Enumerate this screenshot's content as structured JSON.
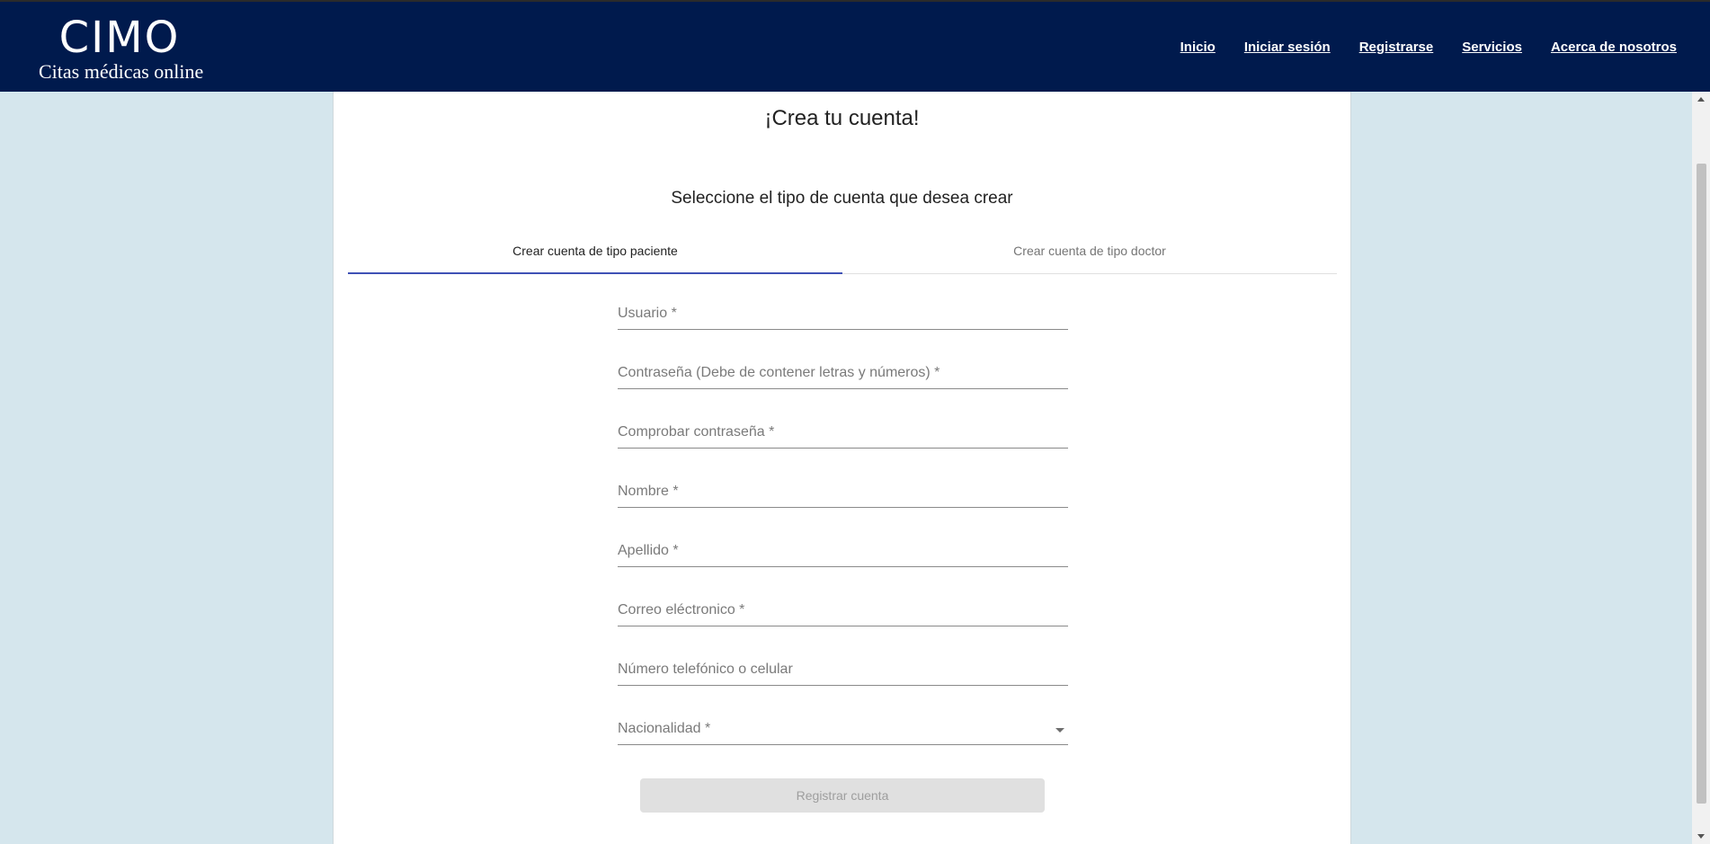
{
  "header": {
    "logo_title": "CIMO",
    "logo_subtitle": "Citas médicas online",
    "nav": [
      "Inicio",
      "Iniciar sesión",
      "Registrarse",
      "Servicios",
      "Acerca de nosotros"
    ]
  },
  "main": {
    "title": "¡Crea tu cuenta!",
    "subtitle": "Seleccione el tipo de cuenta que desea crear",
    "tabs": [
      {
        "label": "Crear cuenta de tipo paciente",
        "active": true
      },
      {
        "label": "Crear cuenta de tipo doctor",
        "active": false
      }
    ],
    "fields": [
      {
        "label": "Usuario *"
      },
      {
        "label": "Contraseña (Debe de contener letras y números) *"
      },
      {
        "label": "Comprobar contraseña *"
      },
      {
        "label": "Nombre *"
      },
      {
        "label": "Apellido *"
      },
      {
        "label": "Correo eléctronico *"
      },
      {
        "label": "Número telefónico o celular"
      },
      {
        "label": "Nacionalidad *"
      }
    ],
    "submit_label": "Registrar cuenta"
  },
  "colors": {
    "navbar": "#001a4d",
    "background": "#d5e6ed",
    "tab_indicator": "#3f51b5"
  }
}
